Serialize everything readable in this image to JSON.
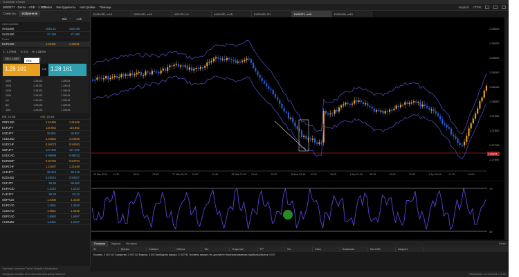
{
  "titlebar": "Tradeslab cTrader",
  "account": "3000377 · Demo · USD · 1:100",
  "menus": [
    "cTrader",
    "Инструменты",
    "Настройки",
    "Помощь"
  ],
  "top_right": [
    "support",
    "cTDN"
  ],
  "chart_tabs": [
    "EURUSD, m15",
    "GBPUSD, m15",
    "USDJPY, h1",
    "AUDUSD, m15",
    "EURUSD, D1",
    "EURJPY, m15",
    "EURUSD, m15"
  ],
  "left_tabs": [
    "Символы",
    "Избранное"
  ],
  "bid_ask": [
    "Bid",
    "Ask"
  ],
  "groups": [
    "Commodities",
    "Forex"
  ],
  "commodities": [
    {
      "sym": "XAUUSD",
      "bid": "1591.51",
      "ask": "1591.88"
    },
    {
      "sym": "XAGUSD",
      "bid": "27.166",
      "ask": "27.190"
    }
  ],
  "trade": {
    "symbol": "EURUSD",
    "bid": "1.28161",
    "ask": "1.28161",
    "lot": "100k",
    "sell_label": "Sell",
    "buy_label": "Buy",
    "sell_price": "1.28 101",
    "buy_price": "1.28 161",
    "spread": "0.6",
    "sl_label": "SELL LIMIT",
    "bl_label": "BUY LIMIT",
    "l_val": "L: 1.27661",
    "s_val": "S: 1.0",
    "h_val": "H: 1.28200"
  },
  "depth": [
    [
      "100k",
      "1.28161",
      "1.28161"
    ],
    [
      "250k",
      "1.28151",
      "1.28161"
    ],
    [
      "150k",
      "1.28151",
      "1.28161"
    ],
    [
      "100k",
      "1.28161",
      "1.28161"
    ],
    [
      "1m",
      "1.28161",
      "1.28161"
    ],
    [
      "5m",
      "1.28151",
      "1.28161"
    ],
    [
      "10m",
      "1.28151",
      "1.28161"
    ]
  ],
  "depth_footer": [
    "Bid: 10.5м",
    "Ask: 10.5м"
  ],
  "pairs": [
    {
      "sym": "GBPUSD",
      "bid": "1.61456",
      "ask": "1.61466",
      "up": true
    },
    {
      "sym": "EURJPY",
      "bid": "116.652",
      "ask": "116.662",
      "up": true
    },
    {
      "sym": "USDJPY",
      "bid": "90.981",
      "ask": "90.987",
      "up": false
    },
    {
      "sym": "AUDUSD",
      "bid": "1.04654",
      "ask": "1.04666",
      "up": true
    },
    {
      "sym": "USDCHF",
      "bid": "0.94073",
      "ask": "0.94083",
      "up": true
    },
    {
      "sym": "GBPJPY",
      "bid": "147.380",
      "ask": "147.392",
      "up": false
    },
    {
      "sym": "USDCAD",
      "bid": "0.98998",
      "ask": "0.99010",
      "up": false
    },
    {
      "sym": "EURGBP",
      "bid": "0.84784",
      "ask": "0.84794",
      "up": true
    },
    {
      "sym": "EURCHF",
      "bid": "1.21637",
      "ask": "1.21648",
      "up": true
    },
    {
      "sym": "AUDJPY",
      "bid": "95.204",
      "ask": "95.218",
      "up": false
    },
    {
      "sym": "NZDUSD",
      "bid": "0.84014",
      "ask": "0.84027",
      "up": false
    },
    {
      "sym": "CHFJPY",
      "bid": "96.48",
      "ask": "96.500",
      "up": false
    },
    {
      "sym": "EURAUD",
      "bid": "1.2242",
      "ask": "1.2243",
      "up": false
    },
    {
      "sym": "CADJPY",
      "bid": "92.20",
      "ask": "92.22",
      "up": false
    },
    {
      "sym": "GBPAUD",
      "bid": "1.4435",
      "ask": "1.4438",
      "up": true
    },
    {
      "sym": "EURCAD",
      "bid": "1.2691",
      "ask": "1.2693",
      "up": false
    },
    {
      "sym": "AUDCAD",
      "bid": "1.0621",
      "ask": "1.0625",
      "up": true
    },
    {
      "sym": "GBPCAD",
      "bid": "1.5984",
      "ask": "1.5987",
      "up": false
    },
    {
      "sym": "AUDNZD",
      "bid": "1.2451",
      "ask": "1.2457",
      "up": false
    }
  ],
  "left_status": "Торговые системы  Trader  Analytics  Котировки",
  "order_tabs": [
    "Позиции",
    "Ордера",
    "История"
  ],
  "order_headers": [
    "ID",
    "Время",
    "Символ",
    "Объем",
    "Тип",
    "Открытие",
    "T/P",
    "S/L",
    "Своп",
    "Комиссия",
    "Net USD",
    "Закрыть"
  ],
  "balance_line": "Баланс: 3 007.82   Средства: 3 007.82   Маржа: 0.00   Свободная маржа: 3 007.82   Уровень маржи: Не доступно   Нереализованная прибыль/убыток: 0.00",
  "close_all": "Close",
  "app_status": "Трейдеры онлайн   Тест   Система   Кэш-флоу   Новости",
  "app_status_right": "Обновлено: 10.04.2013 | 12:16",
  "chart_prices": [
    "1.28500",
    "1.28400",
    "1.28300",
    "1.28200",
    "1.28100",
    "1.28000",
    "1.27900",
    "1.27800",
    "1.27700",
    "1.27600"
  ],
  "time_labels": [
    "26 Mar 2013",
    "11:30",
    "18:15",
    "02:45",
    "27 Mar 08:15",
    "15:00",
    "21:45",
    "28 Mar 07:00",
    "13:45",
    "20:30",
    "29 Mar 03:15",
    "10:00",
    "16:45",
    "1 Apr 01:30",
    "08:15",
    "15:00",
    "21:45",
    "2 Apr 04:30",
    "11:15",
    "18:00"
  ],
  "osc_labels": [
    "70",
    "30"
  ],
  "current_price": "1.28161",
  "colors": {
    "bull": "#e8a030",
    "bear": "#2a5dd6",
    "band": "#4a4ab8",
    "osc": "#6040d8",
    "level": "#aa2222"
  }
}
